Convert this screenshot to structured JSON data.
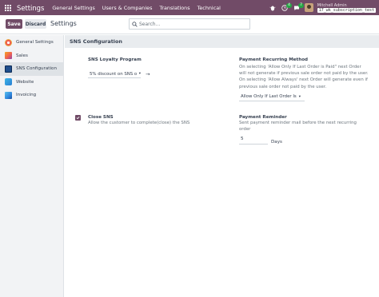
{
  "navbar": {
    "app_title": "Settings",
    "menu": [
      "General Settings",
      "Users & Companies",
      "Translations",
      "Technical"
    ],
    "activity_count": "4",
    "message_count": "7",
    "user_name": "Mitchell Admin",
    "database": "17_wk_subscription_test",
    "colors": {
      "bar": "#714b67",
      "badge": "#28a745"
    }
  },
  "control_panel": {
    "save_label": "Save",
    "discard_label": "Discard",
    "title": "Settings",
    "search_placeholder": "Search..."
  },
  "sidebar": {
    "items": [
      {
        "label": "General Settings",
        "icon": "odoo-logo-icon",
        "active": false
      },
      {
        "label": "Sales",
        "icon": "sales-chart-icon",
        "active": false
      },
      {
        "label": "SNS Configuration",
        "icon": "sns-app-icon",
        "active": true
      },
      {
        "label": "Website",
        "icon": "website-globe-icon",
        "active": false
      },
      {
        "label": "Invoicing",
        "icon": "invoicing-icon",
        "active": false
      }
    ]
  },
  "main": {
    "section_title": "SNS Configuration",
    "loyalty": {
      "title": "SNS Loyalty Program",
      "value": "5% discount on SNS o"
    },
    "payment_method": {
      "title": "Payment Recurring Method",
      "description": [
        "On selecting 'Allow Only If Last Order is Paid\" next Order",
        "will not generate if previous sale order not paid by the user.",
        "On selecting 'Allow Always' next Order will generate even if",
        "previous sale order not paid by the user."
      ],
      "value": "Allow Only If Last Order Is"
    },
    "close_sns": {
      "title": "Close SNS",
      "description": "Allow the customer to complete(close) the SNS",
      "checked": true
    },
    "payment_reminder": {
      "title": "Payment Reminder",
      "description": [
        "Sent payment reminder mail before the next recurring",
        "order"
      ],
      "value": "5",
      "unit": "Days"
    }
  }
}
